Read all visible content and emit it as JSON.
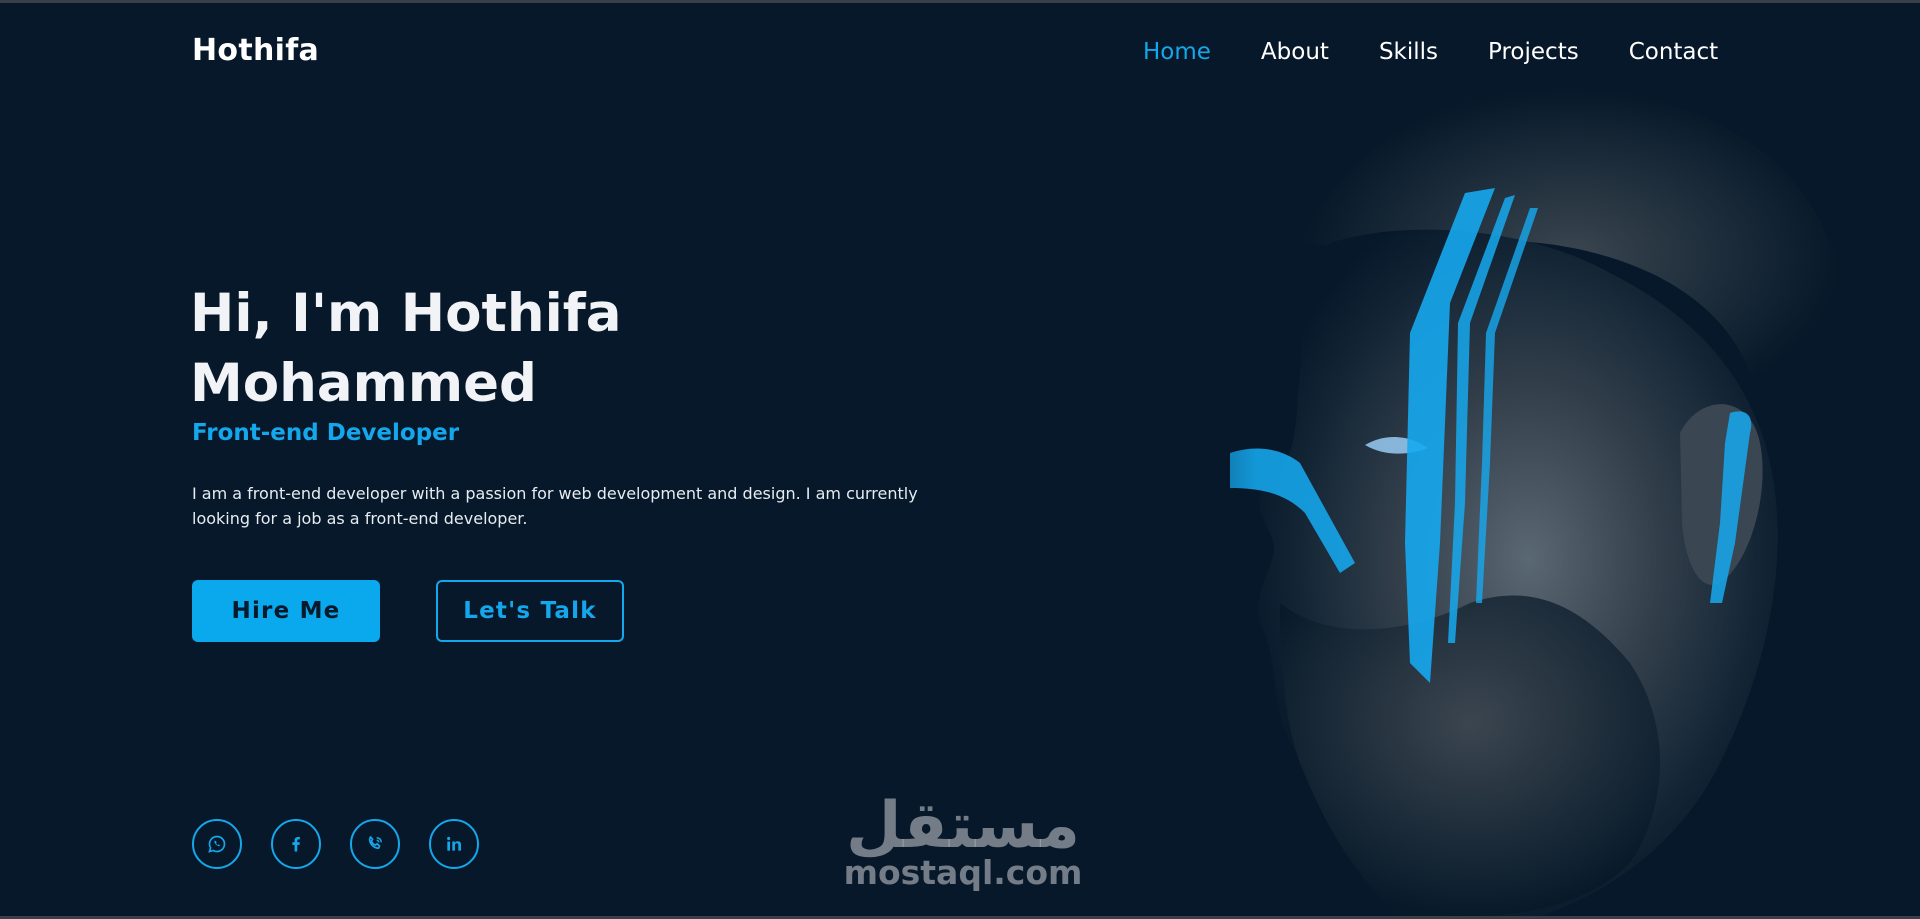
{
  "brand": "Hothifa",
  "nav": {
    "items": [
      {
        "label": "Home",
        "active": true
      },
      {
        "label": "About",
        "active": false
      },
      {
        "label": "Skills",
        "active": false
      },
      {
        "label": "Projects",
        "active": false
      },
      {
        "label": "Contact",
        "active": false
      }
    ]
  },
  "hero": {
    "title_line1": "Hi, I'm Hothifa",
    "title_line2": "Mohammed",
    "subtitle": "Front-end Developer",
    "description": "I am a front-end developer with a passion for web development and design. I am currently looking for a job as a front-end developer.",
    "primary_button": "Hire Me",
    "secondary_button": "Let's Talk"
  },
  "social": [
    {
      "icon": "whatsapp-icon"
    },
    {
      "icon": "facebook-icon"
    },
    {
      "icon": "phone-icon"
    },
    {
      "icon": "linkedin-icon"
    }
  ],
  "watermark": {
    "arabic": "مستقل",
    "latin": "mostaql.com"
  },
  "colors": {
    "background": "#061829",
    "accent": "#14a7ec",
    "text": "#ffffff"
  }
}
